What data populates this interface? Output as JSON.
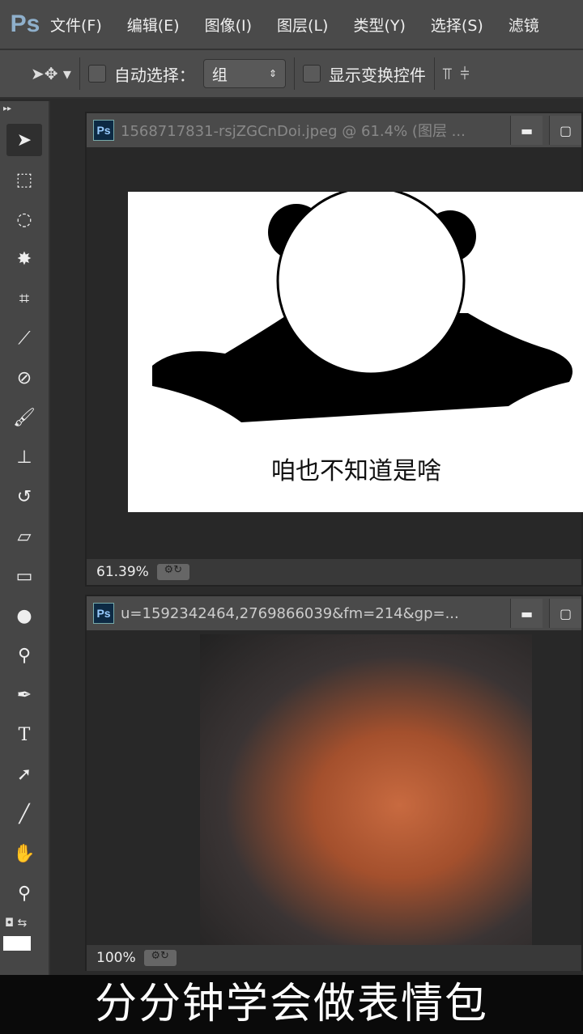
{
  "app": {
    "logo": "Ps"
  },
  "menu": [
    "文件(F)",
    "编辑(E)",
    "图像(I)",
    "图层(L)",
    "类型(Y)",
    "选择(S)",
    "滤镜"
  ],
  "options": {
    "auto_select_label": "自动选择：",
    "group_value": "组",
    "show_transform_label": "显示变换控件"
  },
  "doc1": {
    "title": "1568717831-rsjZGCnDoi.jpeg @ 61.4% (图层 ...",
    "zoom": "61.39%",
    "image_caption": "咱也不知道是啥"
  },
  "doc2": {
    "title": "u=1592342464,2769866039&fm=214&gp=...",
    "zoom": "100%"
  },
  "caption": "分分钟学会做表情包"
}
